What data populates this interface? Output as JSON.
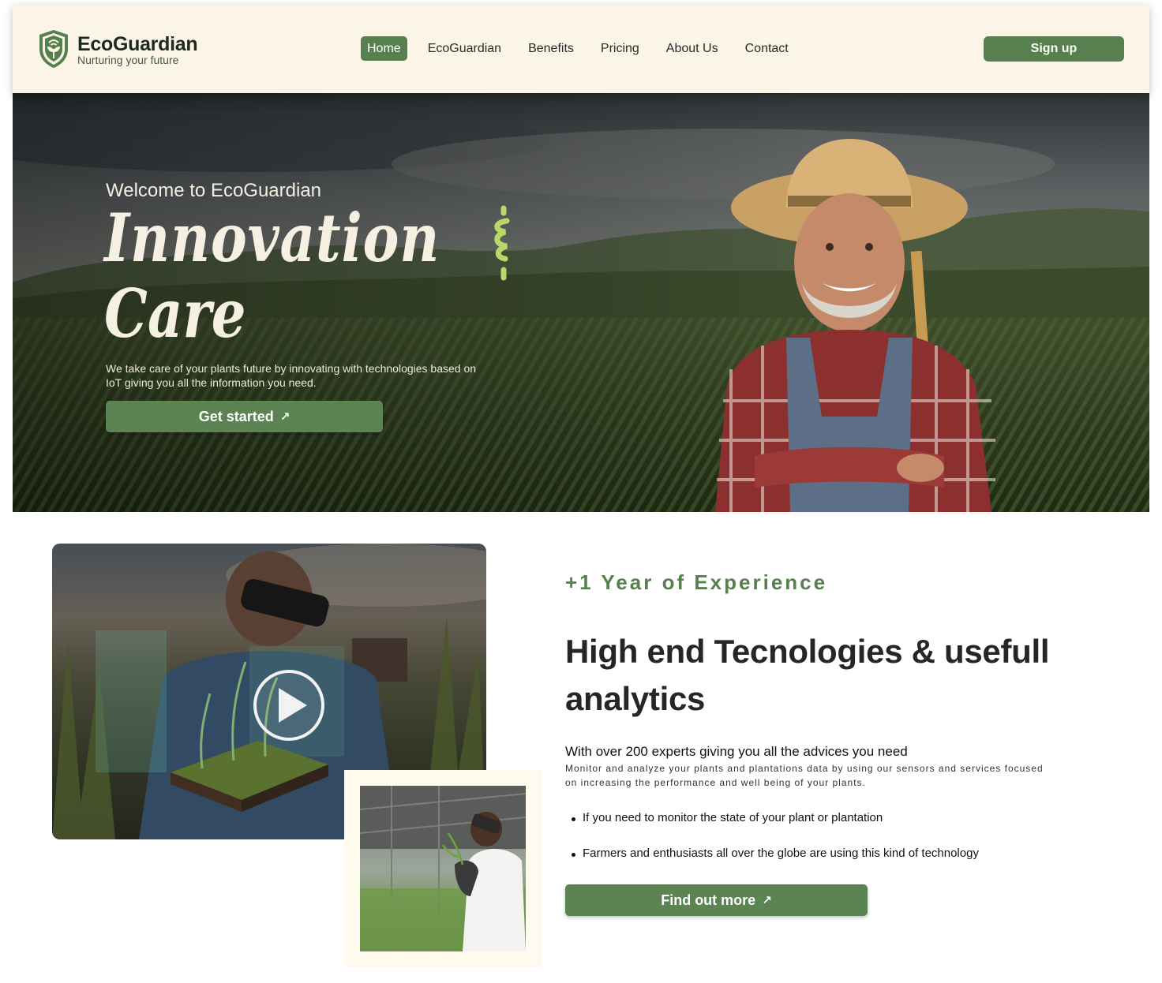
{
  "brand": {
    "name": "EcoGuardian",
    "tagline": "Nurturing your future",
    "logo_icon": "shield-plant-icon",
    "accent_color": "#57804f",
    "header_bg": "#fbf5e8"
  },
  "nav": {
    "items": [
      {
        "label": "Home",
        "active": true
      },
      {
        "label": "EcoGuardian",
        "active": false
      },
      {
        "label": "Benefits",
        "active": false
      },
      {
        "label": "Pricing",
        "active": false
      },
      {
        "label": "About Us",
        "active": false
      },
      {
        "label": "Contact",
        "active": false
      }
    ],
    "signup_label": "Sign up"
  },
  "hero": {
    "welcome": "Welcome to EcoGuardian",
    "title_line1": "Innovation",
    "title_line2": "Care",
    "description": "We take care of your plants future by innovating with technologies based on IoT giving you all the information you need.",
    "cta_label": "Get started",
    "cta_icon": "arrow-up-right-icon",
    "accent_squiggle_color": "#b9d86a"
  },
  "about": {
    "video_icon": "play-icon",
    "experience": "+1 Year of Experience",
    "title": "High end Tecnologies & usefull analytics",
    "subhead": "With over 200 experts giving you all the advices you need",
    "description": "Monitor and analyze your plants and plantations data by using our sensors and services focused on increasing the performance and well being of your plants.",
    "bullets": [
      "If you need to monitor the state of your plant or plantation",
      "Farmers and enthusiasts all over the globe are using this kind of technology"
    ],
    "cta_label": "Find out more",
    "cta_icon": "arrow-up-right-icon"
  }
}
